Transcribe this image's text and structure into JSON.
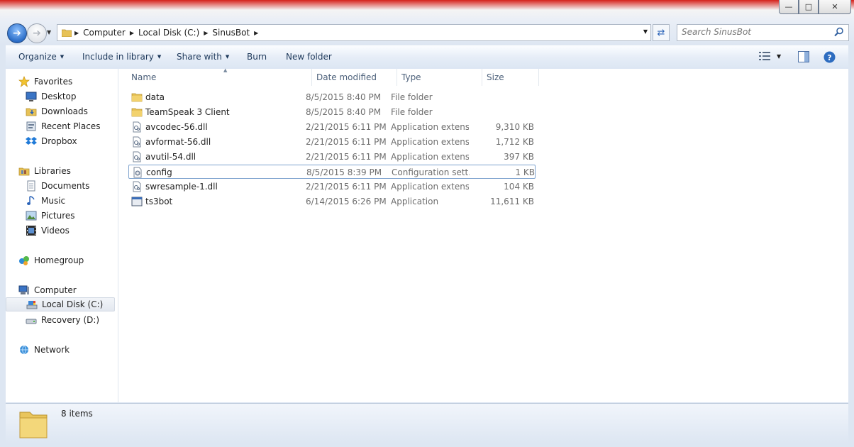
{
  "window": {
    "buttons": {
      "minimize": "minimize-icon",
      "maximize": "maximize-icon",
      "close": "close-icon"
    }
  },
  "address": {
    "breadcrumbs": [
      "Computer",
      "Local Disk (C:)",
      "SinusBot"
    ],
    "search_placeholder": "Search SinusBot"
  },
  "toolbar": {
    "organize": "Organize",
    "include": "Include in library",
    "share": "Share with",
    "burn": "Burn",
    "new_folder": "New folder"
  },
  "sidebar": {
    "favorites": {
      "label": "Favorites",
      "items": [
        "Desktop",
        "Downloads",
        "Recent Places",
        "Dropbox"
      ]
    },
    "libraries": {
      "label": "Libraries",
      "items": [
        "Documents",
        "Music",
        "Pictures",
        "Videos"
      ]
    },
    "homegroup": "Homegroup",
    "computer": {
      "label": "Computer",
      "items": [
        "Local Disk (C:)",
        "Recovery (D:)"
      ]
    },
    "network": "Network"
  },
  "columns": {
    "name": "Name",
    "date": "Date modified",
    "type": "Type",
    "size": "Size"
  },
  "files": [
    {
      "name": "data",
      "date": "8/5/2015 8:40 PM",
      "type": "File folder",
      "size": "",
      "icon": "folder-icon"
    },
    {
      "name": "TeamSpeak 3 Client",
      "date": "8/5/2015 8:40 PM",
      "type": "File folder",
      "size": "",
      "icon": "folder-icon"
    },
    {
      "name": "avcodec-56.dll",
      "date": "2/21/2015 6:11 PM",
      "type": "Application extens...",
      "size": "9,310 KB",
      "icon": "dll-file-icon"
    },
    {
      "name": "avformat-56.dll",
      "date": "2/21/2015 6:11 PM",
      "type": "Application extens...",
      "size": "1,712 KB",
      "icon": "dll-file-icon"
    },
    {
      "name": "avutil-54.dll",
      "date": "2/21/2015 6:11 PM",
      "type": "Application extens...",
      "size": "397 KB",
      "icon": "dll-file-icon"
    },
    {
      "name": "config",
      "date": "8/5/2015 8:39 PM",
      "type": "Configuration sett...",
      "size": "1 KB",
      "icon": "config-file-icon"
    },
    {
      "name": "swresample-1.dll",
      "date": "2/21/2015 6:11 PM",
      "type": "Application extens...",
      "size": "104 KB",
      "icon": "dll-file-icon"
    },
    {
      "name": "ts3bot",
      "date": "6/14/2015 6:26 PM",
      "type": "Application",
      "size": "11,611 KB",
      "icon": "application-icon"
    }
  ],
  "details": {
    "count": "8 items"
  }
}
